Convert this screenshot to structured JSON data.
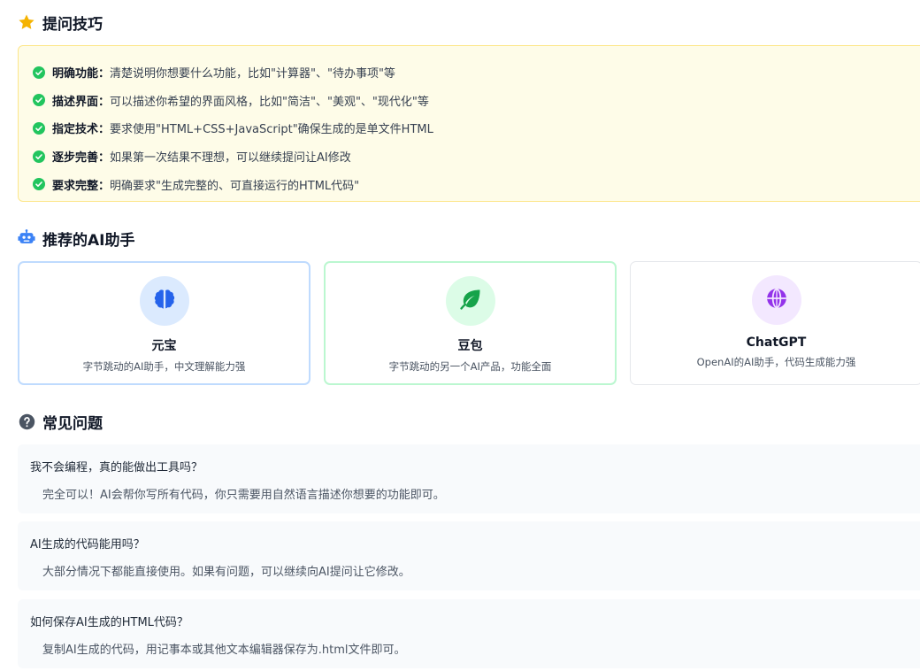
{
  "tips": {
    "title": "提问技巧",
    "items": [
      {
        "key": "明确功能：",
        "text": "清楚说明你想要什么功能，比如\"计算器\"、\"待办事项\"等"
      },
      {
        "key": "描述界面：",
        "text": "可以描述你希望的界面风格，比如\"简洁\"、\"美观\"、\"现代化\"等"
      },
      {
        "key": "指定技术：",
        "text": "要求使用\"HTML+CSS+JavaScript\"确保生成的是单文件HTML"
      },
      {
        "key": "逐步完善：",
        "text": "如果第一次结果不理想，可以继续提问让AI修改"
      },
      {
        "key": "要求完整：",
        "text": "明确要求\"生成完整的、可直接运行的HTML代码\""
      }
    ]
  },
  "assistants": {
    "title": "推荐的AI助手",
    "cards": [
      {
        "name": "元宝",
        "desc": "字节跳动的AI助手，中文理解能力强",
        "icon": "brain-icon",
        "color": "#2563eb",
        "bg": "#dbeafe"
      },
      {
        "name": "豆包",
        "desc": "字节跳动的另一个AI产品，功能全面",
        "icon": "leaf-icon",
        "color": "#16a34a",
        "bg": "#dcfce7"
      },
      {
        "name": "ChatGPT",
        "desc": "OpenAI的AI助手，代码生成能力强",
        "icon": "globe-icon",
        "color": "#9333ea",
        "bg": "#f3e8ff"
      }
    ]
  },
  "faq": {
    "title": "常见问题",
    "items": [
      {
        "q": "我不会编程，真的能做出工具吗？",
        "a": "完全可以！AI会帮你写所有代码，你只需要用自然语言描述你想要的功能即可。"
      },
      {
        "q": "AI生成的代码能用吗？",
        "a": "大部分情况下都能直接使用。如果有问题，可以继续向AI提问让它修改。"
      },
      {
        "q": "如何保存AI生成的HTML代码？",
        "a": "复制AI生成的代码，用记事本或其他文本编辑器保存为.html文件即可。"
      }
    ]
  },
  "colors": {
    "star": "#f5b301",
    "check": "#22c55e",
    "robot": "#3b82f6",
    "question": "#4b5563"
  }
}
